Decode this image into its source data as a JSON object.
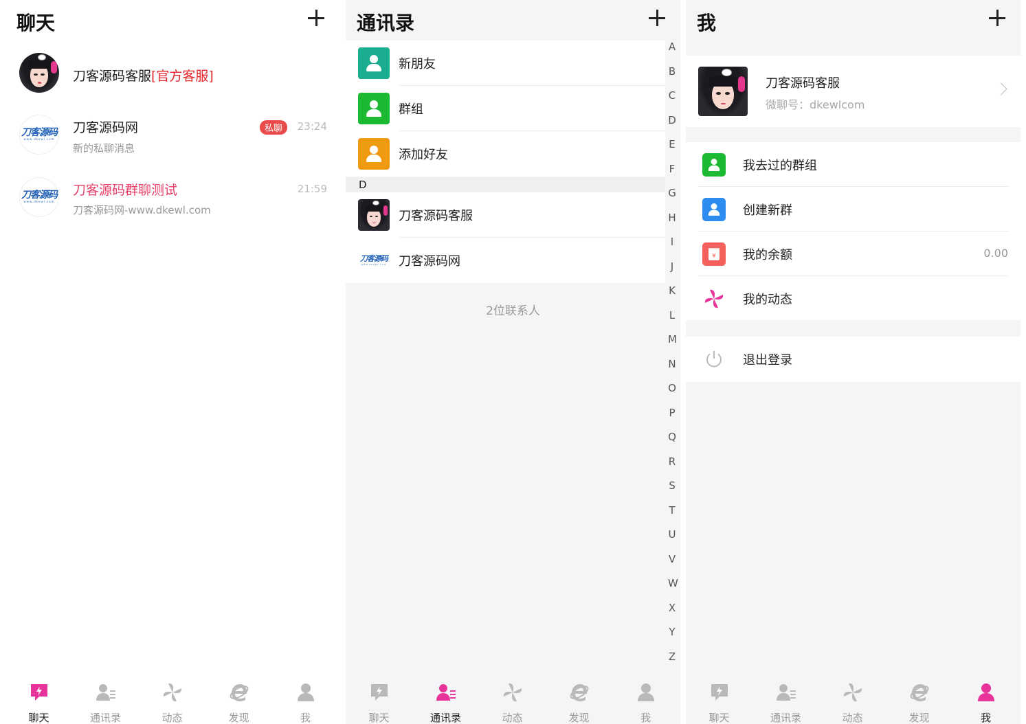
{
  "colors": {
    "accent": "#e8339a",
    "grey_icon": "#b9b9b9",
    "red_text": "#e2242b",
    "pink_text": "#e7406a"
  },
  "chat": {
    "title": "聊天",
    "items": [
      {
        "name": "刀客源码客服",
        "tag": "[官方客服]",
        "message": "",
        "time": "",
        "badge": ""
      },
      {
        "name": "刀客源码网",
        "message": "新的私聊消息",
        "time": "23:24",
        "badge": "私聊"
      },
      {
        "name": "刀客源码群聊测试",
        "message": "刀客源码网-www.dkewl.com",
        "time": "21:59",
        "badge": ""
      }
    ]
  },
  "contacts": {
    "title": "通讯录",
    "fixed": [
      {
        "label": "新朋友",
        "icon": "person-plus-icon",
        "color": "#1aad8f"
      },
      {
        "label": "群组",
        "icon": "people-icon",
        "color": "#1cb932"
      },
      {
        "label": "添加好友",
        "icon": "add-person-icon",
        "color": "#f09a12"
      }
    ],
    "section": "D",
    "people": [
      {
        "label": "刀客源码客服"
      },
      {
        "label": "刀客源码网"
      }
    ],
    "count": "2位联系人",
    "alphabet": [
      "A",
      "B",
      "C",
      "D",
      "E",
      "F",
      "G",
      "H",
      "I",
      "J",
      "K",
      "L",
      "M",
      "N",
      "O",
      "P",
      "Q",
      "R",
      "S",
      "T",
      "U",
      "V",
      "W",
      "X",
      "Y",
      "Z"
    ]
  },
  "me": {
    "title": "我",
    "name": "刀客源码客服",
    "id": "微聊号：dkewlcom",
    "menu": [
      {
        "label": "我去过的群组",
        "icon": "group-icon",
        "color": "#1cb932",
        "value": ""
      },
      {
        "label": "创建新群",
        "icon": "create-group-icon",
        "color": "#2d8cf0",
        "value": ""
      },
      {
        "label": "我的余额",
        "icon": "wallet-icon",
        "color": "#f4605b",
        "value": "0.00"
      },
      {
        "label": "我的动态",
        "icon": "pinwheel-icon",
        "color": "#e8339a",
        "value": ""
      }
    ],
    "logout": "退出登录"
  },
  "logo": {
    "text": "刀客源码",
    "sub": "www.dkewl.com"
  },
  "tabs": [
    {
      "label": "聊天",
      "icon": "chat-bolt-icon"
    },
    {
      "label": "通讯录",
      "icon": "contacts-icon"
    },
    {
      "label": "动态",
      "icon": "pinwheel-icon"
    },
    {
      "label": "发现",
      "icon": "browser-e-icon"
    },
    {
      "label": "我",
      "icon": "user-icon"
    }
  ]
}
